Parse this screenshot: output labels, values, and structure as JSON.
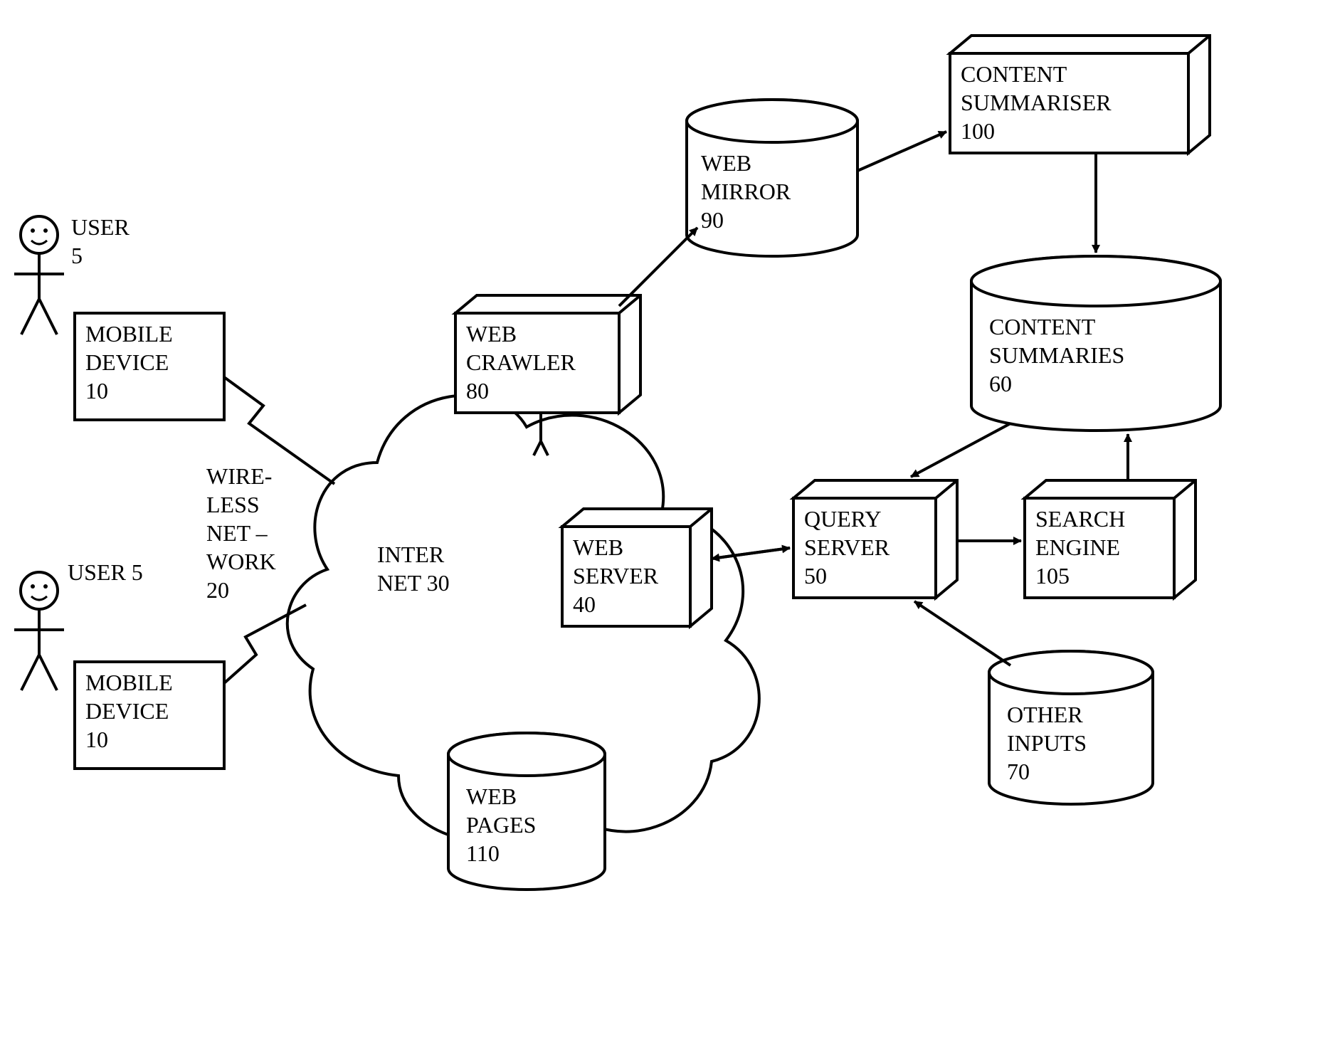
{
  "nodes": {
    "user1": {
      "label1": "USER",
      "label2": "5"
    },
    "user2": {
      "label": "USER 5"
    },
    "mobile1": {
      "line1": "MOBILE",
      "line2": "DEVICE",
      "line3": "10"
    },
    "mobile2": {
      "line1": "MOBILE",
      "line2": "DEVICE",
      "line3": "10"
    },
    "wireless": {
      "line1": "WIRE-",
      "line2": "LESS",
      "line3": "NET –",
      "line4": "WORK",
      "line5": "20"
    },
    "internet": {
      "line1": "INTER",
      "line2": "NET 30"
    },
    "web_server": {
      "line1": "WEB",
      "line2": "SERVER",
      "line3": "40"
    },
    "web_crawler": {
      "line1": "WEB",
      "line2": "CRAWLER",
      "line3": "80"
    },
    "web_mirror": {
      "line1": "WEB",
      "line2": "MIRROR",
      "line3": "90"
    },
    "content_summariser": {
      "line1": "CONTENT",
      "line2": "SUMMARISER",
      "line3": "100"
    },
    "content_summaries": {
      "line1": "CONTENT",
      "line2": "SUMMARIES",
      "line3": "60"
    },
    "query_server": {
      "line1": "QUERY",
      "line2": "SERVER",
      "line3": "50"
    },
    "search_engine": {
      "line1": "SEARCH",
      "line2": "ENGINE",
      "line3": "105"
    },
    "other_inputs": {
      "line1": "OTHER",
      "line2": "INPUTS",
      "line3": "70"
    },
    "web_pages": {
      "line1": "WEB",
      "line2": "PAGES",
      "line3": "110"
    }
  }
}
